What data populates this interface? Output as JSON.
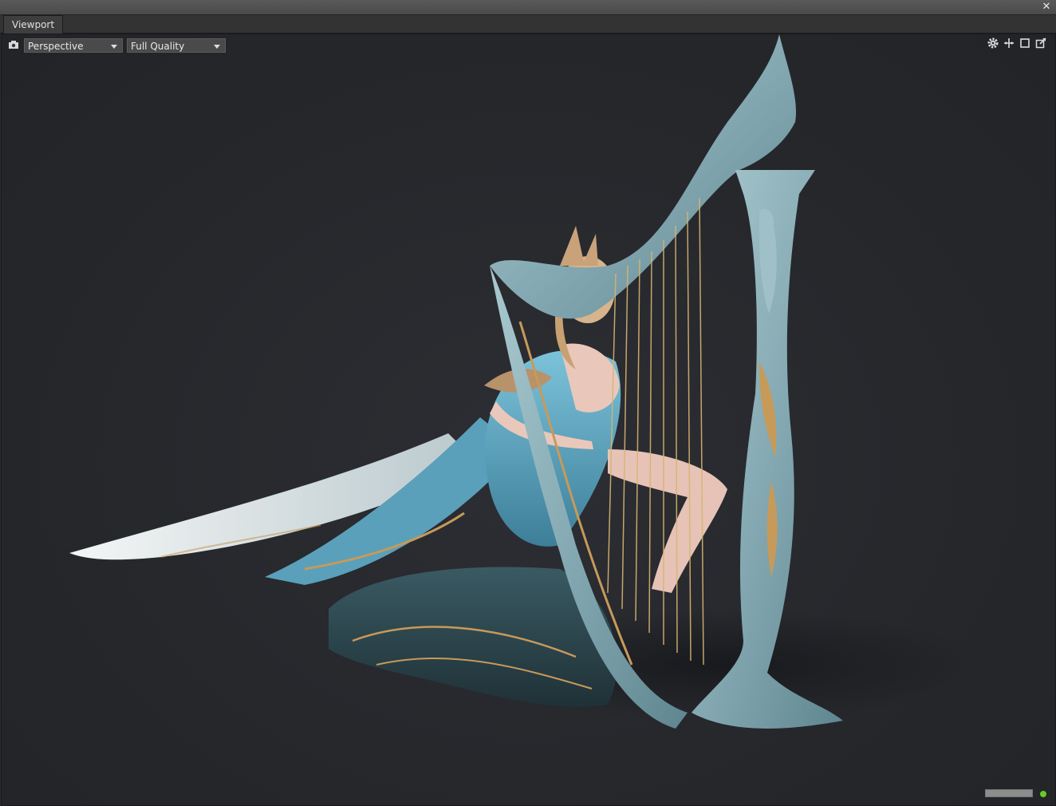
{
  "window": {
    "close_glyph": "✕",
    "tab_label": "Viewport"
  },
  "viewport": {
    "camera_dropdown": {
      "selected": "Perspective"
    },
    "quality_dropdown": {
      "selected": "Full Quality"
    },
    "icons": [
      "camera-icon",
      "gear-icon",
      "pan-icon",
      "maximize-icon",
      "popout-icon"
    ],
    "render_progress": 1.0,
    "status_color": "#66cc22"
  },
  "colors": {
    "background": "#25272b",
    "harp": "#8fb3bb",
    "dress": "#6cb4cf",
    "gold": "#c79a5a",
    "cape": "#e8eef0"
  }
}
